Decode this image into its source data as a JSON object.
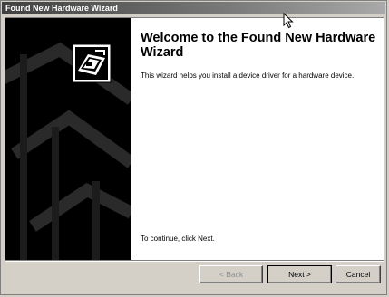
{
  "window": {
    "title": "Found New Hardware Wizard"
  },
  "wizard": {
    "heading": "Welcome to the Found New Hardware Wizard",
    "intro": "This wizard helps you install a device driver for a hardware device.",
    "continue_hint": "To continue, click Next."
  },
  "buttons": {
    "back": "< Back",
    "next": "Next >",
    "cancel": "Cancel"
  },
  "icons": {
    "logo": "hardware-wizard-icon",
    "cursor": "mouse-pointer-icon"
  },
  "colors": {
    "sidebar": "#000000",
    "dialog": "#d4d0c8",
    "titlebar_start": "#404040",
    "titlebar_end": "#a9a9a9"
  }
}
